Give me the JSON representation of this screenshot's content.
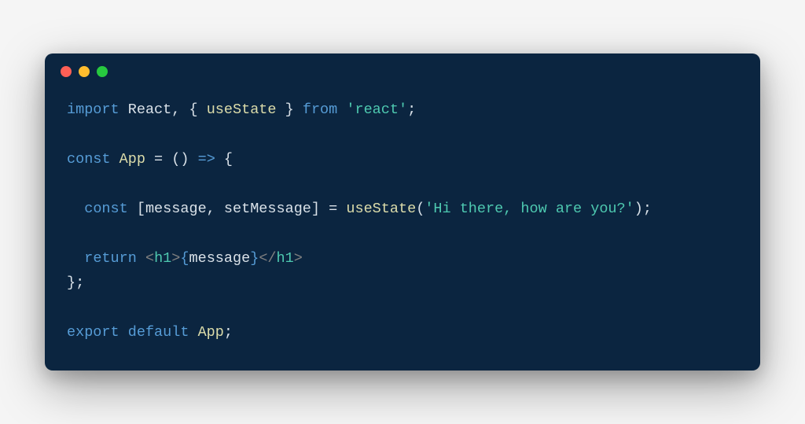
{
  "code": {
    "line1": {
      "import": "import",
      "react": "React",
      "comma1": ",",
      "lbrace": "{",
      "useState": "useState",
      "rbrace": "}",
      "from": "from",
      "reactStr": "'react'",
      "semi": ";"
    },
    "line3": {
      "const": "const",
      "app": "App",
      "eq": "=",
      "lparen": "(",
      "rparen": ")",
      "arrow": "=>",
      "lbrace": "{"
    },
    "line5": {
      "indent": "  ",
      "const": "const",
      "lbracket": "[",
      "message": "message",
      "comma": ",",
      "setMessage": "setMessage",
      "rbracket": "]",
      "eq": "=",
      "useState": "useState",
      "lparen": "(",
      "str": "'Hi there, how are you?'",
      "rparen": ")",
      "semi": ";"
    },
    "line7": {
      "indent": "  ",
      "return": "return",
      "lt1": "<",
      "h1a": "h1",
      "gt1": ">",
      "lbrace": "{",
      "message": "message",
      "rbrace": "}",
      "lt2": "</",
      "h1b": "h1",
      "gt2": ">"
    },
    "line8": {
      "rbrace": "}",
      "semi": ";"
    },
    "line10": {
      "export": "export",
      "default": "default",
      "app": "App",
      "semi": ";"
    }
  }
}
